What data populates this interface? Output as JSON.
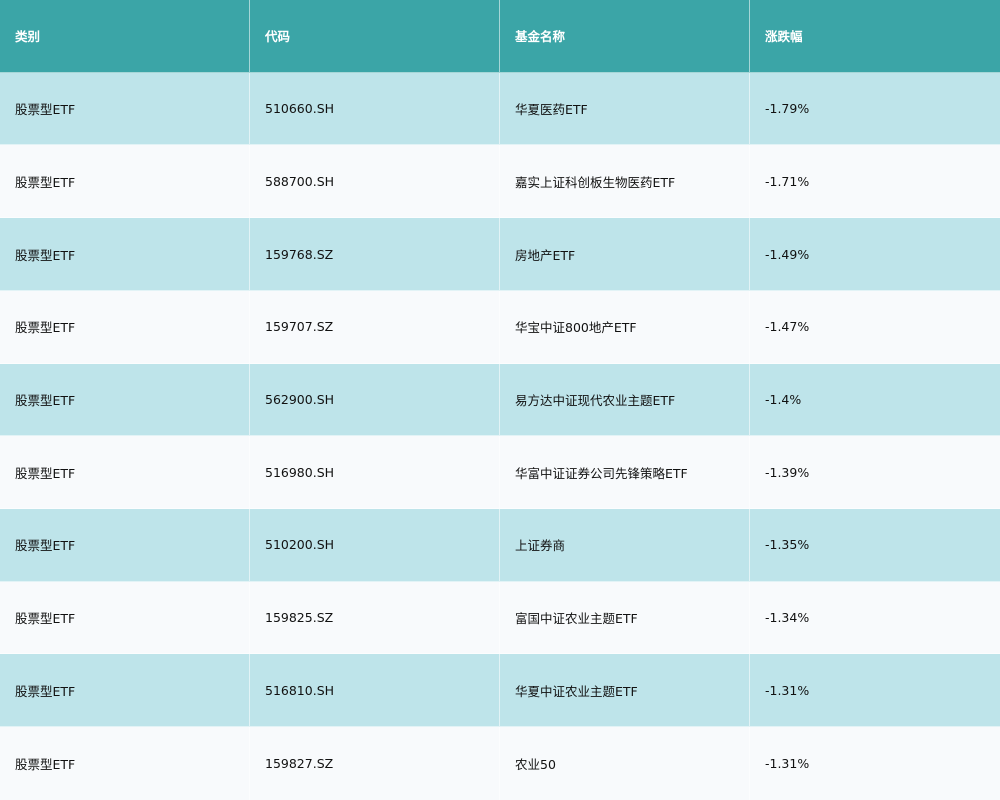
{
  "table": {
    "columns": [
      "类别",
      "代码",
      "基金名称",
      "涨跌幅"
    ],
    "rows": [
      {
        "category": "股票型ETF",
        "code": "510660.SH",
        "name": "华夏医药ETF",
        "change": "-1.79%"
      },
      {
        "category": "股票型ETF",
        "code": "588700.SH",
        "name": "嘉实上证科创板生物医药ETF",
        "change": "-1.71%"
      },
      {
        "category": "股票型ETF",
        "code": "159768.SZ",
        "name": "房地产ETF",
        "change": "-1.49%"
      },
      {
        "category": "股票型ETF",
        "code": "159707.SZ",
        "name": "华宝中证800地产ETF",
        "change": "-1.47%"
      },
      {
        "category": "股票型ETF",
        "code": "562900.SH",
        "name": "易方达中证现代农业主题ETF",
        "change": "-1.4%"
      },
      {
        "category": "股票型ETF",
        "code": "516980.SH",
        "name": "华富中证证券公司先锋策略ETF",
        "change": "-1.39%"
      },
      {
        "category": "股票型ETF",
        "code": "510200.SH",
        "name": "上证券商",
        "change": "-1.35%"
      },
      {
        "category": "股票型ETF",
        "code": "159825.SZ",
        "name": "富国中证农业主题ETF",
        "change": "-1.34%"
      },
      {
        "category": "股票型ETF",
        "code": "516810.SH",
        "name": "华夏中证农业主题ETF",
        "change": "-1.31%"
      },
      {
        "category": "股票型ETF",
        "code": "159827.SZ",
        "name": "农业50",
        "change": "-1.31%"
      }
    ]
  },
  "colors": {
    "header": "#3ba5a7",
    "row_tinted": "#bee4ea",
    "row_plain": "#f8fafc"
  }
}
